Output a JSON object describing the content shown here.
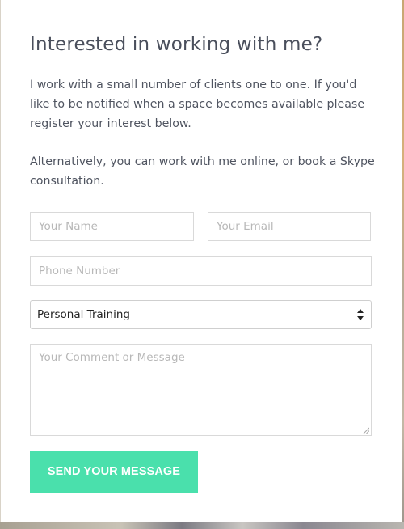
{
  "form": {
    "title": "Interested in working with me?",
    "intro": "I work with a small number of clients one to one. If you'd like to be notified when a space becomes available please register your interest below.",
    "alternative": "Alternatively, you can work with me online, or book a Skype consultation.",
    "fields": {
      "name": {
        "value": "",
        "placeholder": "Your Name"
      },
      "email": {
        "value": "",
        "placeholder": "Your Email"
      },
      "phone": {
        "value": "",
        "placeholder": "Phone Number"
      },
      "service": {
        "selected": "Personal Training"
      },
      "message": {
        "value": "",
        "placeholder": "Your Comment or Message"
      }
    },
    "submit_label": "SEND YOUR MESSAGE"
  },
  "colors": {
    "accent": "#4ae0ac",
    "text": "#4f5460",
    "placeholder": "#b8b8b8",
    "border": "#d9d9d9"
  },
  "icons": {
    "select": "updown-chevron-icon",
    "textarea": "resize-grip-icon"
  }
}
